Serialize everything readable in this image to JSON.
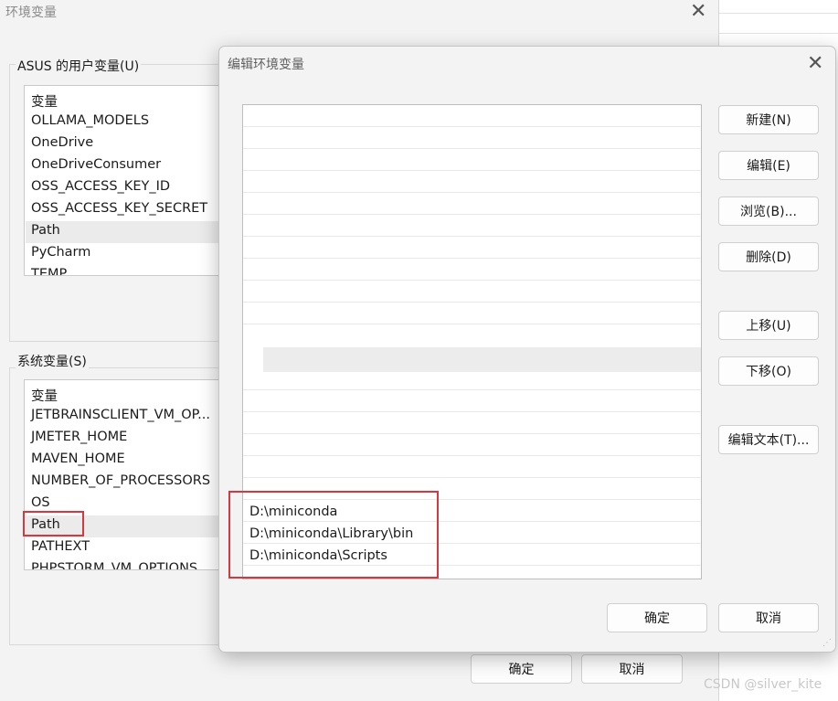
{
  "env_window": {
    "title": "环境变量",
    "user_group_label": "ASUS 的用户变量(U)",
    "user_vars_header": "变量",
    "user_vars": [
      "OLLAMA_MODELS",
      "OneDrive",
      "OneDriveConsumer",
      "OSS_ACCESS_KEY_ID",
      "OSS_ACCESS_KEY_SECRET",
      "Path",
      "PyCharm",
      "TEMP"
    ],
    "system_group_label": "系统变量(S)",
    "system_vars_header": "变量",
    "system_vars": [
      "JETBRAINSCLIENT_VM_OP...",
      "JMETER_HOME",
      "MAVEN_HOME",
      "NUMBER_OF_PROCESSORS",
      "OS",
      "Path",
      "PATHEXT",
      "PHPSTORM_VM_OPTIONS"
    ],
    "ok_label": "确定",
    "cancel_label": "取消"
  },
  "edit_dialog": {
    "title": "编辑环境变量",
    "path_entries": [
      "D:\\miniconda",
      "D:\\miniconda\\Library\\bin",
      "D:\\miniconda\\Scripts"
    ],
    "buttons": {
      "new": "新建(N)",
      "edit": "编辑(E)",
      "browse": "浏览(B)...",
      "delete": "删除(D)",
      "move_up": "上移(U)",
      "move_down": "下移(O)",
      "edit_text": "编辑文本(T)...",
      "ok": "确定",
      "cancel": "取消"
    }
  },
  "watermark": "CSDN @silver_kite",
  "colors": {
    "highlight_border": "#d9363e",
    "selected_row": "#ebebeb"
  }
}
